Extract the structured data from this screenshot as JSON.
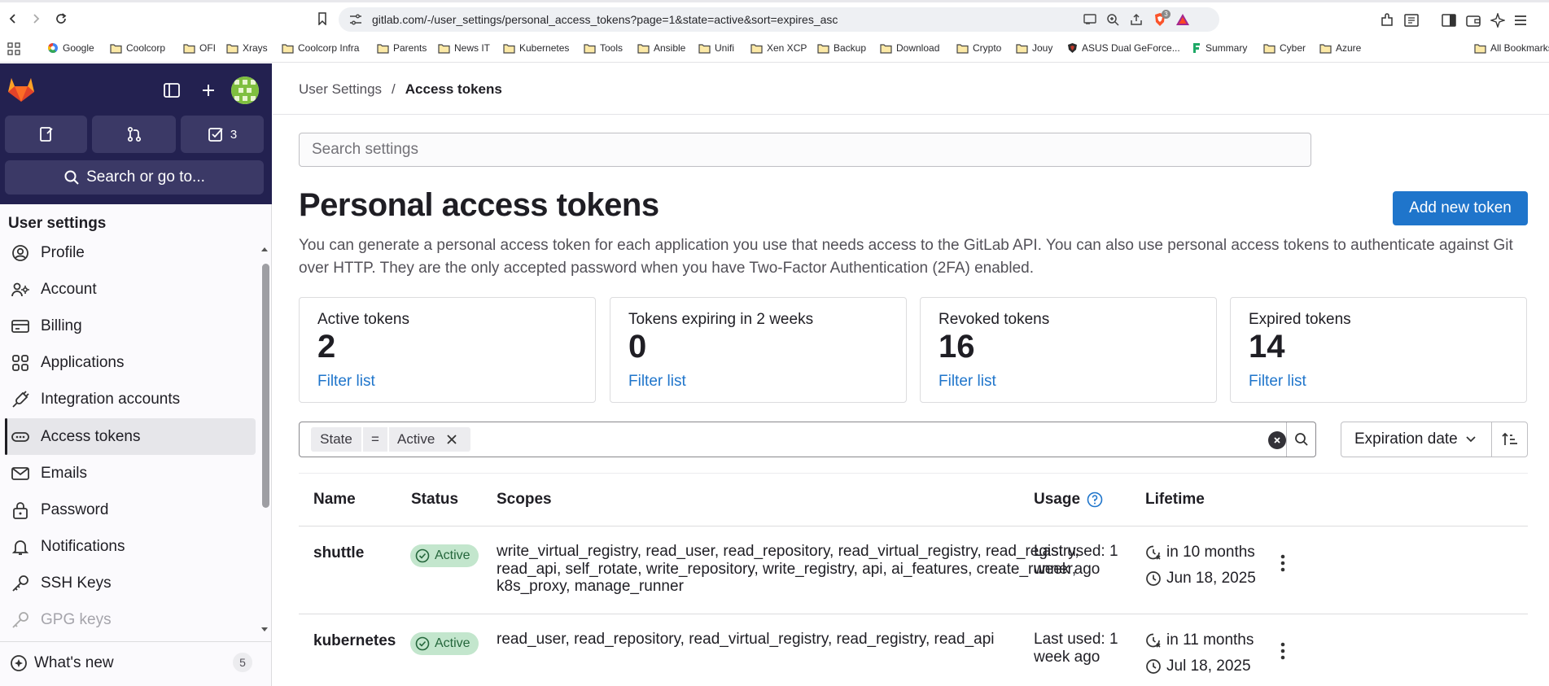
{
  "browser": {
    "url": "gitlab.com/-/user_settings/personal_access_tokens?page=1&state=active&sort=expires_asc",
    "bookmarks": [
      "Google",
      "Coolcorp",
      "OFI",
      "Xrays",
      "Coolcorp Infra",
      "Parents",
      "News IT",
      "Kubernetes",
      "Tools",
      "Ansible",
      "Unifi",
      "Xen XCP",
      "Backup",
      "Download",
      "Crypto",
      "Jouy",
      "ASUS Dual GeForce...",
      "Summary",
      "Cyber",
      "Azure"
    ],
    "all_bookmarks": "All Bookmarks",
    "brave_badge": "3"
  },
  "sidebar": {
    "todo_count": "3",
    "search_label": "Search or go to...",
    "heading": "User settings",
    "items": [
      {
        "label": "Profile",
        "icon": "profile-icon"
      },
      {
        "label": "Account",
        "icon": "account-icon"
      },
      {
        "label": "Billing",
        "icon": "billing-icon"
      },
      {
        "label": "Applications",
        "icon": "applications-icon"
      },
      {
        "label": "Integration accounts",
        "icon": "integration-icon"
      },
      {
        "label": "Access tokens",
        "icon": "token-icon",
        "active": true
      },
      {
        "label": "Emails",
        "icon": "email-icon"
      },
      {
        "label": "Password",
        "icon": "lock-icon"
      },
      {
        "label": "Notifications",
        "icon": "bell-icon"
      },
      {
        "label": "SSH Keys",
        "icon": "key-icon"
      },
      {
        "label": "GPG keys",
        "icon": "key-icon"
      }
    ],
    "whats_new": "What's new",
    "whats_new_count": "5"
  },
  "main": {
    "breadcrumb": {
      "parent": "User Settings",
      "sep": "/",
      "current": "Access tokens"
    },
    "search_placeholder": "Search settings",
    "title": "Personal access tokens",
    "add_button": "Add new token",
    "description": "You can generate a personal access token for each application you use that needs access to the GitLab API. You can also use personal access tokens to authenticate against Git over HTTP. They are the only accepted password when you have Two-Factor Authentication (2FA) enabled.",
    "cards": [
      {
        "label": "Active tokens",
        "value": "2",
        "link": "Filter list"
      },
      {
        "label": "Tokens expiring in 2 weeks",
        "value": "0",
        "link": "Filter list"
      },
      {
        "label": "Revoked tokens",
        "value": "16",
        "link": "Filter list"
      },
      {
        "label": "Expired tokens",
        "value": "14",
        "link": "Filter list"
      }
    ],
    "filter": {
      "token_key": "State",
      "operator": "=",
      "token_value": "Active"
    },
    "sort": {
      "label": "Expiration date"
    },
    "table": {
      "headers": {
        "name": "Name",
        "status": "Status",
        "scopes": "Scopes",
        "usage": "Usage",
        "lifetime": "Lifetime"
      },
      "rows": [
        {
          "name": "shuttle",
          "status": "Active",
          "scopes": "write_virtual_registry, read_user, read_repository, read_virtual_registry, read_registry, read_api, self_rotate, write_repository, write_registry, api, ai_features, create_runner, k8s_proxy, manage_runner",
          "usage": "Last used: 1 week ago",
          "expires_in": "in 10 months",
          "created": "Jun 18, 2025"
        },
        {
          "name": "kubernetes",
          "status": "Active",
          "scopes": "read_user, read_repository, read_virtual_registry, read_registry, read_api",
          "usage": "Last used: 1 week ago",
          "expires_in": "in 11 months",
          "created": "Jul 18, 2025"
        }
      ]
    }
  },
  "colors": {
    "sidebar_top": "#232150",
    "primary": "#1f75cb",
    "success_bg": "#c3e6cd",
    "success_text": "#24663b"
  }
}
